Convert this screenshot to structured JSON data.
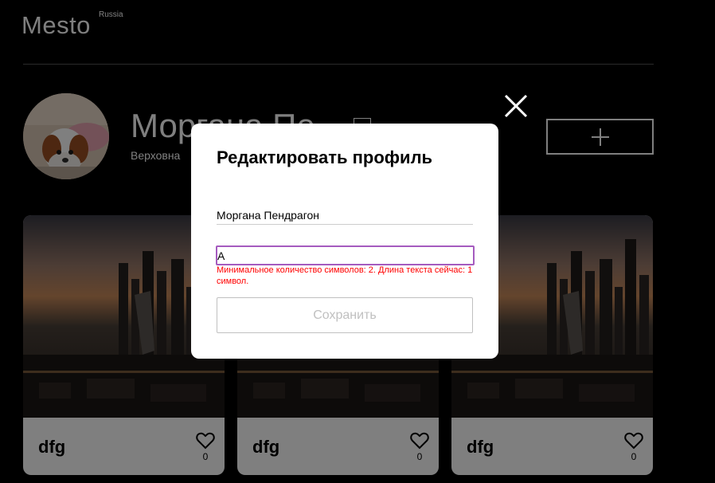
{
  "header": {
    "logo": "Mesto",
    "logo_sup": "Russia"
  },
  "profile": {
    "name": "Моргана Пе",
    "about": "Верховна",
    "avatar_icon": "puppy-avatar",
    "edit_icon": "pencil-icon",
    "add_icon": "plus-icon"
  },
  "cards": [
    {
      "title": "dfg",
      "likes": "0",
      "image_icon": "city-skyline-image",
      "like_icon": "heart-icon"
    },
    {
      "title": "dfg",
      "likes": "0",
      "image_icon": "city-skyline-image",
      "like_icon": "heart-icon"
    },
    {
      "title": "dfg",
      "likes": "0",
      "image_icon": "city-skyline-image",
      "like_icon": "heart-icon"
    }
  ],
  "popup": {
    "title": "Редактировать профиль",
    "name_value": "Моргана Пендрагон",
    "about_value": "A",
    "error": "Минимальное количество символов: 2. Длина текста сейчас: 1 символ.",
    "save_label": "Сохранить",
    "close_icon": "close-icon"
  },
  "colors": {
    "background": "#000000",
    "error": "#ff0000",
    "focus_border": "#a55bbf",
    "disabled": "#c0c0c0"
  }
}
